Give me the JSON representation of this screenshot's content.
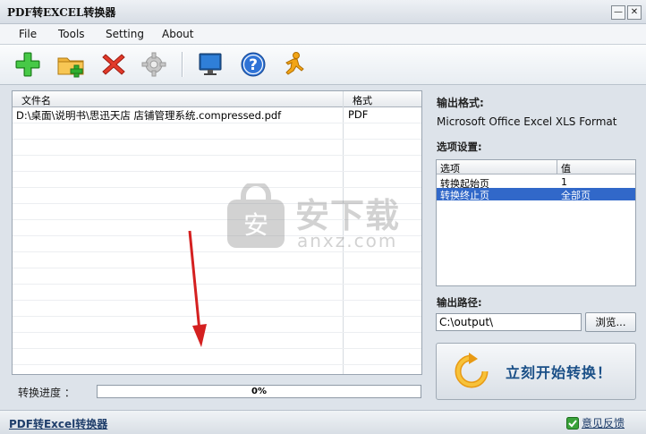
{
  "window": {
    "title": "PDF转EXCEL转换器"
  },
  "menu": {
    "items": [
      "File",
      "Tools",
      "Setting",
      "About"
    ]
  },
  "toolbar": {
    "buttons": [
      "add-file-icon",
      "add-folder-icon",
      "delete-icon",
      "settings-gear-icon",
      "monitor-icon",
      "help-icon",
      "runner-icon"
    ]
  },
  "file_list": {
    "columns": [
      "文件名",
      "格式"
    ],
    "rows": [
      {
        "name": "D:\\桌面\\说明书\\思迅天店 店铺管理系统.compressed.pdf",
        "format": "PDF"
      }
    ]
  },
  "progress": {
    "label": "转换进度 ：",
    "value": 0,
    "text": "0%"
  },
  "output": {
    "format_label": "输出格式:",
    "format_value": "Microsoft Office Excel XLS Format",
    "options_label": "选项设置:",
    "options_columns": [
      "选项",
      "值"
    ],
    "options": [
      {
        "option": "转换起始页",
        "value": "1",
        "selected": false
      },
      {
        "option": "转换终止页",
        "value": "全部页",
        "selected": true
      }
    ],
    "path_label": "输出路径:",
    "path_value": "C:\\output\\",
    "browse_label": "浏览..."
  },
  "start_button": {
    "label": "立刻开始转换！"
  },
  "status": {
    "link": "PDF转Excel转换器",
    "feedback": "意见反馈"
  },
  "watermark": {
    "text1": "安下载",
    "text2": "anxz.com"
  },
  "colors": {
    "selection": "#3168c9",
    "accent": "#1a4f87",
    "arrow": "#d42020"
  }
}
